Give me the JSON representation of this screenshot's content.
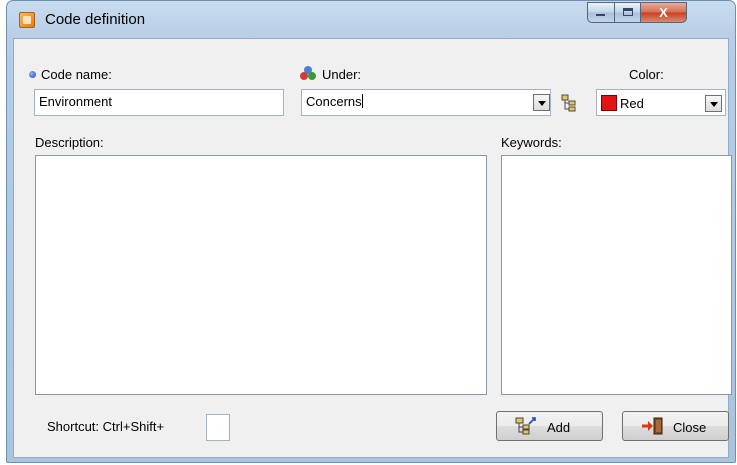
{
  "window": {
    "title": "Code definition",
    "close_glyph": "X"
  },
  "code_name": {
    "label": "Code name:",
    "value": "Environment"
  },
  "under": {
    "label": "Under:",
    "value": "Concerns"
  },
  "color": {
    "label": "Color:",
    "value": "Red",
    "swatch": "#e41313"
  },
  "description": {
    "label": "Description:",
    "value": ""
  },
  "keywords": {
    "label": "Keywords:",
    "value": ""
  },
  "shortcut": {
    "label": "Shortcut: Ctrl+Shift+",
    "value": ""
  },
  "buttons": {
    "add": "Add",
    "close": "Close"
  },
  "icons": {
    "app": "app-icon",
    "under": "categories-icon",
    "tree": "code-tree-icon",
    "add": "add-code-icon",
    "close": "exit-door-icon"
  }
}
